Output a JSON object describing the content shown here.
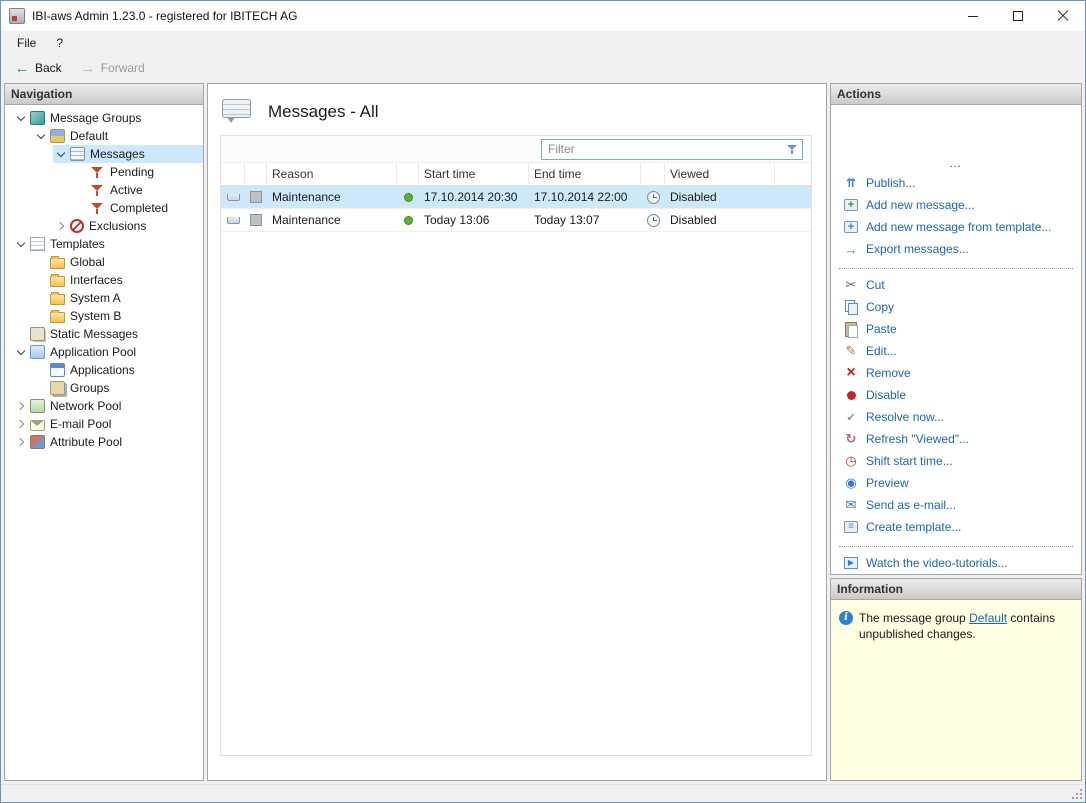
{
  "window": {
    "title": "IBI-aws Admin 1.23.0 - registered for IBITECH AG"
  },
  "menu": {
    "file": "File",
    "help": "?"
  },
  "toolbar": {
    "back": "Back",
    "forward": "Forward"
  },
  "navigation": {
    "header": "Navigation",
    "tree": [
      {
        "label": "Message Groups",
        "level": "0",
        "exp": "open",
        "icon": "message-groups-icon",
        "selected": "false"
      },
      {
        "label": "Default",
        "level": "1",
        "exp": "open",
        "icon": "default-group-icon",
        "selected": "false"
      },
      {
        "label": "Messages",
        "level": "2",
        "exp": "open",
        "icon": "messages-node-icon",
        "selected": "true"
      },
      {
        "label": "Pending",
        "level": "3",
        "exp": "leaf",
        "icon": "filter-pending-icon",
        "selected": "false"
      },
      {
        "label": "Active",
        "level": "3",
        "exp": "leaf",
        "icon": "filter-active-icon",
        "selected": "false"
      },
      {
        "label": "Completed",
        "level": "3",
        "exp": "leaf",
        "icon": "filter-completed-icon",
        "selected": "false"
      },
      {
        "label": "Exclusions",
        "level": "2",
        "exp": "closed",
        "icon": "exclusions-icon",
        "selected": "false"
      },
      {
        "label": "Templates",
        "level": "0",
        "exp": "open",
        "icon": "templates-icon",
        "selected": "false"
      },
      {
        "label": "Global",
        "level": "1",
        "exp": "leaf",
        "icon": "folder-icon",
        "selected": "false"
      },
      {
        "label": "Interfaces",
        "level": "1",
        "exp": "leaf",
        "icon": "folder-icon",
        "selected": "false"
      },
      {
        "label": "System A",
        "level": "1",
        "exp": "leaf",
        "icon": "folder-icon",
        "selected": "false"
      },
      {
        "label": "System B",
        "level": "1",
        "exp": "leaf",
        "icon": "folder-icon",
        "selected": "false"
      },
      {
        "label": "Static Messages",
        "level": "0",
        "exp": "leaf",
        "icon": "static-messages-icon",
        "selected": "false"
      },
      {
        "label": "Application Pool",
        "level": "0",
        "exp": "open",
        "icon": "application-pool-icon",
        "selected": "false"
      },
      {
        "label": "Applications",
        "level": "1",
        "exp": "leaf",
        "icon": "applications-icon",
        "selected": "false"
      },
      {
        "label": "Groups",
        "level": "1",
        "exp": "leaf",
        "icon": "groups-icon",
        "selected": "false"
      },
      {
        "label": "Network Pool",
        "level": "0",
        "exp": "closed",
        "icon": "network-pool-icon",
        "selected": "false"
      },
      {
        "label": "E-mail Pool",
        "level": "0",
        "exp": "closed",
        "icon": "email-pool-icon",
        "selected": "false"
      },
      {
        "label": "Attribute Pool",
        "level": "0",
        "exp": "closed",
        "icon": "attribute-pool-icon",
        "selected": "false"
      }
    ]
  },
  "main": {
    "title": "Messages - All",
    "filter": {
      "placeholder": "Filter",
      "icon": "funnel-icon"
    },
    "table": {
      "columns": [
        "Reason",
        "Start time",
        "End time",
        "Viewed"
      ],
      "rows": [
        {
          "reason": "Maintenance",
          "start": "17.10.2014 20:30",
          "end": "17.10.2014 22:00",
          "viewed": "Disabled",
          "selected": "true"
        },
        {
          "reason": "Maintenance",
          "start": "Today 13:06",
          "end": "Today 13:07",
          "viewed": "Disabled",
          "selected": "false"
        }
      ]
    }
  },
  "actions": {
    "header": "Actions",
    "items": [
      {
        "type": "action",
        "icon": "publish-icon",
        "label": "Publish..."
      },
      {
        "type": "action",
        "icon": "add-message-icon",
        "label": "Add new message..."
      },
      {
        "type": "action",
        "icon": "add-from-template-icon",
        "label": "Add new message from template..."
      },
      {
        "type": "action",
        "icon": "export-messages-icon",
        "label": "Export messages..."
      },
      {
        "type": "separator"
      },
      {
        "type": "action",
        "icon": "cut-icon",
        "label": "Cut"
      },
      {
        "type": "action",
        "icon": "copy-icon",
        "label": "Copy"
      },
      {
        "type": "action",
        "icon": "paste-icon",
        "label": "Paste"
      },
      {
        "type": "action",
        "icon": "edit-icon",
        "label": "Edit..."
      },
      {
        "type": "action",
        "icon": "remove-icon",
        "label": "Remove"
      },
      {
        "type": "action",
        "icon": "disable-icon",
        "label": "Disable"
      },
      {
        "type": "action",
        "icon": "resolve-icon",
        "label": "Resolve now..."
      },
      {
        "type": "action",
        "icon": "refresh-viewed-icon",
        "label": "Refresh \"Viewed\"..."
      },
      {
        "type": "action",
        "icon": "shift-start-icon",
        "label": "Shift start time..."
      },
      {
        "type": "action",
        "icon": "preview-icon",
        "label": "Preview"
      },
      {
        "type": "action",
        "icon": "send-email-icon",
        "label": "Send as e-mail..."
      },
      {
        "type": "action",
        "icon": "create-template-icon",
        "label": "Create template..."
      },
      {
        "type": "separator"
      },
      {
        "type": "action",
        "icon": "video-tutorials-icon",
        "label": "Watch the video-tutorials..."
      }
    ],
    "overflow": "…"
  },
  "information": {
    "header": "Information",
    "icon": "info-icon",
    "text_before": "The message group ",
    "link_text": "Default",
    "text_after": " contains unpublished changes."
  }
}
